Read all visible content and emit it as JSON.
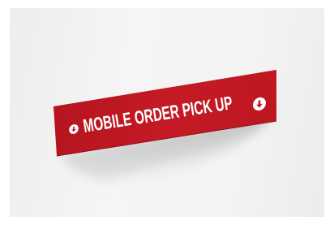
{
  "sign": {
    "text": "MOBILE ORDER PICK UP",
    "left_icon": "down-arrow-circle-icon",
    "right_icon": "down-arrow-circle-icon",
    "color": "#c41824",
    "text_color": "#ffffff"
  },
  "background": {
    "color": "#f2f2f2"
  }
}
